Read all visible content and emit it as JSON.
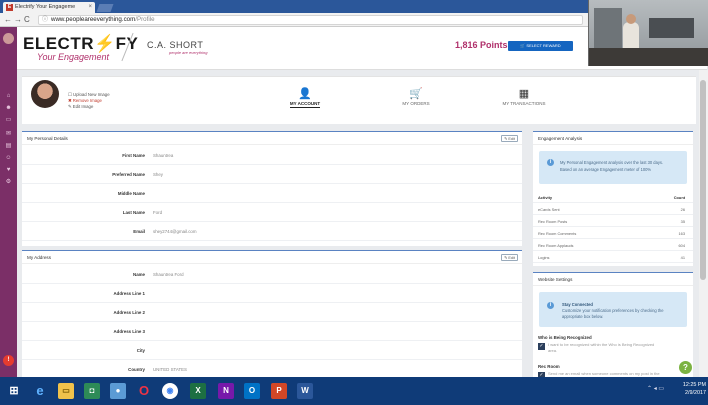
{
  "browser": {
    "tab_title": "Electrify Your Engageme",
    "tab_close": "×",
    "url_domain": "www.peoplearеeverything.com",
    "url_path": "/Profile"
  },
  "site": {
    "brand": "ELECTR",
    "brand_bolt": "⚡",
    "brand_end": "FY",
    "tagline": "Your Engagement",
    "client": "C.A. SHORT",
    "client_sub": "people are everything",
    "points": "1,816 Points",
    "reward_button": "🛒 SELECT REWARD"
  },
  "profile": {
    "upload": "☐ Upload New Image",
    "remove": "✖ Remove Image",
    "edit": "✎ Edit Image",
    "tabs": [
      {
        "label": "MY ACCOUNT",
        "glyph": "👤"
      },
      {
        "label": "MY ORDERS",
        "glyph": "🛒"
      },
      {
        "label": "MY TRANSACTIONS",
        "glyph": "▦"
      }
    ]
  },
  "personal": {
    "title": "My Personal Details",
    "edit": "✎ Edit",
    "fields": [
      {
        "label": "First Name",
        "value": "Shauntrea"
      },
      {
        "label": "Preferred Name",
        "value": "Shey"
      },
      {
        "label": "Middle Name",
        "value": ""
      },
      {
        "label": "Last Name",
        "value": "Ford"
      },
      {
        "label": "Email",
        "value": "shey2744@gmail.com"
      }
    ]
  },
  "address": {
    "title": "My Address",
    "edit": "✎ Edit",
    "fields": [
      {
        "label": "Name",
        "value": "Shauntrea Ford"
      },
      {
        "label": "Address Line 1",
        "value": ""
      },
      {
        "label": "Address Line 2",
        "value": ""
      },
      {
        "label": "Address Line 3",
        "value": ""
      },
      {
        "label": "City",
        "value": ""
      },
      {
        "label": "Country",
        "value": "UNITED STATES"
      }
    ]
  },
  "engagement": {
    "title": "Engagement Analysis",
    "info_line1": "My Personal Engagement analysis over the last 30 days.",
    "info_line2": "Based on an average Engagement meter of 100%",
    "head_activity": "Activity",
    "head_count": "Count",
    "rows": [
      {
        "activity": "eCards Sent",
        "count": "26"
      },
      {
        "activity": "Rec Room Posts",
        "count": "35"
      },
      {
        "activity": "Rec Room Comments",
        "count": "163"
      },
      {
        "activity": "Rec Room Applauds",
        "count": "604"
      },
      {
        "activity": "Logins",
        "count": "41"
      }
    ]
  },
  "website_settings": {
    "title": "Website Settings",
    "stay_title": "Stay Connected",
    "stay_line1": "Customize your notification preferences by checking the",
    "stay_line2": "appropriate box below.",
    "section1": "Who is Being Recognized",
    "option1_line1": "I want to be recognized within the Who is Being Recognized",
    "option1_line2": "area.",
    "section2": "Rec Room",
    "option2_line1": "Send me an email when someone comments on my post in the"
  },
  "help": "?",
  "taskbar": {
    "time": "12:25 PM",
    "date": "2/9/2017"
  },
  "colors": {
    "brand_purple": "#7b2f67",
    "accent_magenta": "#b0306b",
    "primary_blue": "#1565c0",
    "taskbar": "#0f3b78"
  }
}
